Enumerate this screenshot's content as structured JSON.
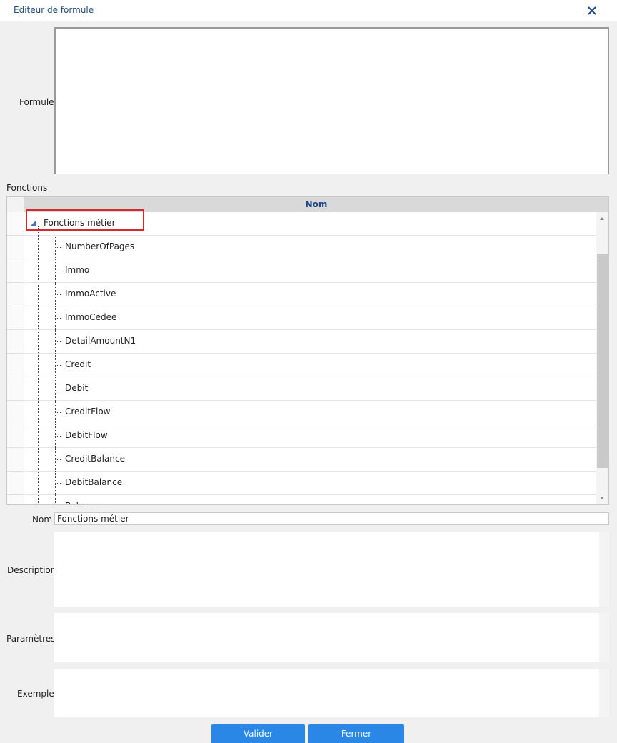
{
  "window": {
    "title": "Editeur de formule",
    "close_icon": "close-icon"
  },
  "formula": {
    "label": "Formule",
    "value": ""
  },
  "functions": {
    "section_label": "Fonctions",
    "column_header": "Nom",
    "root": "Fonctions métier",
    "items": [
      "NumberOfPages",
      "Immo",
      "ImmoActive",
      "ImmoCedee",
      "DetailAmountN1",
      "Credit",
      "Debit",
      "CreditFlow",
      "DebitFlow",
      "CreditBalance",
      "DebitBalance",
      "Balance"
    ]
  },
  "details": {
    "nom_label": "Nom",
    "nom_value": "Fonctions métier",
    "description_label": "Description",
    "parametres_label": "Paramètres",
    "exemple_label": "Exemple"
  },
  "buttons": {
    "valider": "Valider",
    "fermer": "Fermer"
  },
  "colors": {
    "title": "#1d4a8a",
    "button": "#2b87e6",
    "highlight": "#d42a2a"
  }
}
